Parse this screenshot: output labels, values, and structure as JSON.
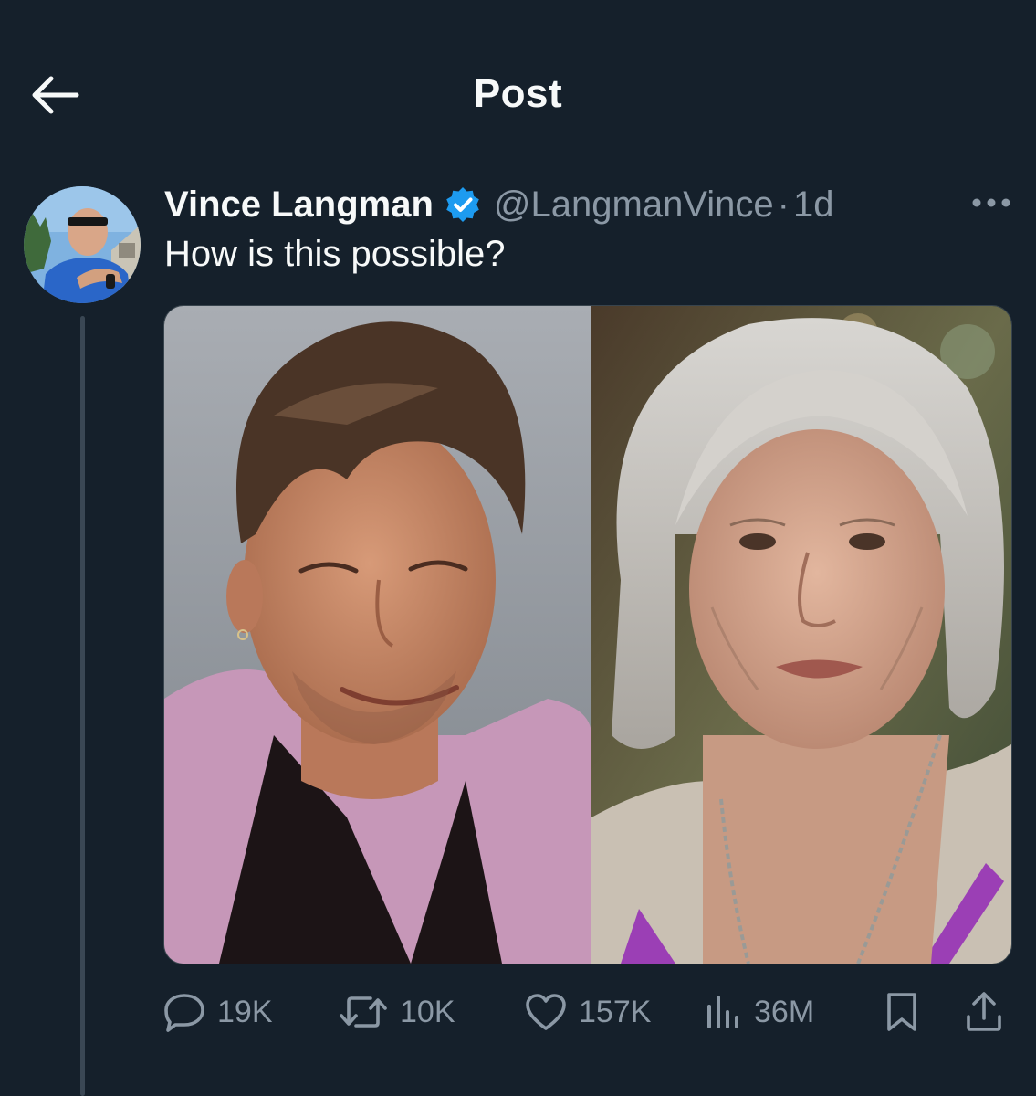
{
  "header": {
    "title": "Post",
    "back_icon": "arrow-left-icon"
  },
  "post": {
    "author": {
      "display_name": "Vince Langman",
      "handle": "@LangmanVince",
      "verified": true,
      "verified_icon": "verified-badge-icon",
      "avatar": "avatar-icon"
    },
    "separator": "·",
    "time": "1d",
    "text": "How is this possible?",
    "more_icon": "more-horizontal-icon"
  },
  "actions": {
    "reply": {
      "icon": "reply-icon",
      "count": "19K"
    },
    "repost": {
      "icon": "repost-icon",
      "count": "10K"
    },
    "like": {
      "icon": "heart-icon",
      "count": "157K"
    },
    "views": {
      "icon": "views-icon",
      "count": "36M"
    },
    "bookmark": {
      "icon": "bookmark-icon"
    },
    "share": {
      "icon": "share-icon"
    }
  },
  "colors": {
    "background": "#15202b",
    "text_primary": "#f7f9f9",
    "text_secondary": "#8b98a5",
    "verified": "#1d9bf0",
    "thread_line": "#3a4754"
  }
}
